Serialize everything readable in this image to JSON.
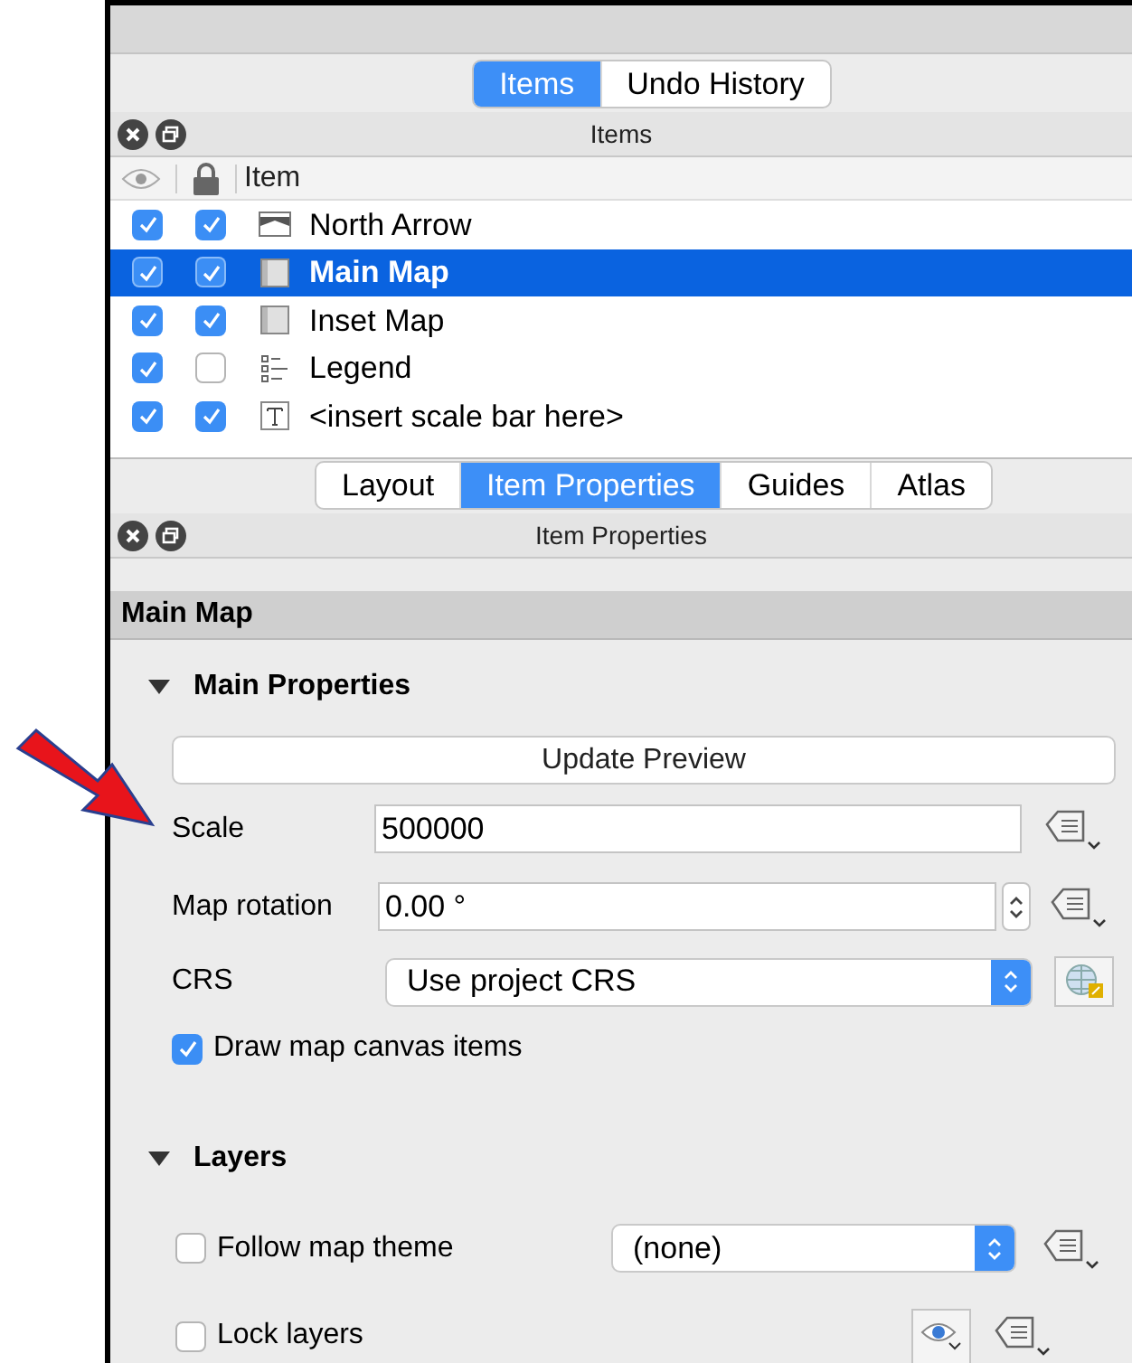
{
  "top_tabs": [
    {
      "label": "Items",
      "selected": true
    },
    {
      "label": "Undo History",
      "selected": false
    }
  ],
  "items_panel": {
    "title": "Items",
    "column": "Item",
    "rows": [
      {
        "label": "North Arrow",
        "kind": "picture",
        "visible": true,
        "locked": true,
        "selected": false
      },
      {
        "label": "Main Map",
        "kind": "map",
        "visible": true,
        "locked": true,
        "selected": true
      },
      {
        "label": "Inset Map",
        "kind": "map",
        "visible": true,
        "locked": true,
        "selected": false
      },
      {
        "label": "Legend",
        "kind": "legend",
        "visible": true,
        "locked": false,
        "selected": false
      },
      {
        "label": "<insert scale bar here>",
        "kind": "label",
        "visible": true,
        "locked": true,
        "selected": false
      }
    ]
  },
  "bottom_tabs": [
    {
      "label": "Layout",
      "selected": false
    },
    {
      "label": "Item Properties",
      "selected": true
    },
    {
      "label": "Guides",
      "selected": false
    },
    {
      "label": "Atlas",
      "selected": false
    }
  ],
  "properties_panel": {
    "title": "Item Properties",
    "item_title": "Main Map",
    "main_properties": {
      "title": "Main Properties",
      "expanded": true,
      "update_button": "Update Preview",
      "scale_label": "Scale",
      "scale_value": "500000",
      "rotation_label": "Map rotation",
      "rotation_value": "0.00 °",
      "crs_label": "CRS",
      "crs_value": "Use project CRS",
      "draw_canvas": {
        "label": "Draw map canvas items",
        "checked": true
      }
    },
    "layers": {
      "title": "Layers",
      "expanded": true,
      "follow_theme": {
        "label": "Follow map theme",
        "checked": false
      },
      "theme_value": "(none)",
      "lock_layers": {
        "label": "Lock layers",
        "checked": false
      }
    }
  }
}
